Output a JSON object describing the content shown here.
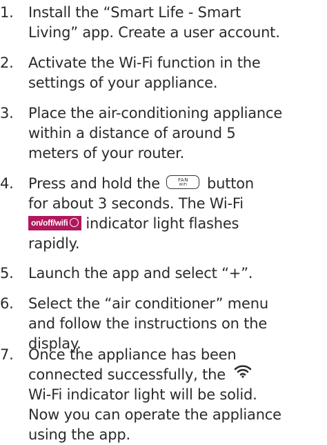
{
  "steps": [
    {
      "number": "1.",
      "lines": [
        "Install the “Smart Life - Smart",
        "Living” app. Create a user account."
      ]
    },
    {
      "number": "2.",
      "lines": [
        "Activate the Wi-Fi function in the",
        "settings of your appliance."
      ]
    },
    {
      "number": "3.",
      "lines": [
        "Place the air-conditioning appliance",
        "within a distance of around 5",
        "meters of your router."
      ]
    },
    {
      "number": "4.",
      "line1_before": "Press and hold the",
      "line1_after": "button",
      "button_label_top": "FAN",
      "button_label_bottom": "WIFI",
      "line2": "for about 3 seconds. The Wi-Fi",
      "badge_label": "on/off/wifi",
      "line3_after": "indicator light flashes",
      "line4": "rapidly."
    },
    {
      "number": "5.",
      "lines": [
        "Launch the app and select “+”."
      ]
    },
    {
      "number": "6.",
      "lines": [
        "Select the “air conditioner” menu",
        "and follow the instructions on the",
        "display."
      ]
    },
    {
      "number": "7.",
      "line1": "Once the appliance has been",
      "line2_before": "connected successfully, the",
      "icon": "wifi-icon",
      "line3": "Wi-Fi indicator light will be solid.",
      "line4": "Now you can operate the appliance",
      "line5": "using the app."
    }
  ],
  "colors": {
    "text": "#2a2a2a",
    "badge_background": "#b0185c",
    "badge_text": "#ffffff"
  }
}
